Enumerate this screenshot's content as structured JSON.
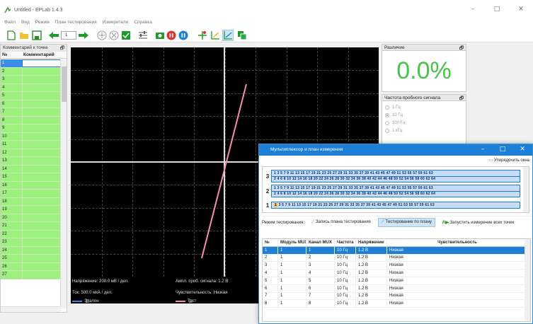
{
  "window": {
    "title": "Untitled - EPLab 1.4.3",
    "min": "–",
    "max": "□",
    "close": "✕"
  },
  "menu": [
    "Файл",
    "Вид",
    "Режим",
    "План тестирования",
    "Измерители",
    "Справка"
  ],
  "toolbar": {
    "point_number": "1"
  },
  "left_panel": {
    "title": "Комментарий к точке",
    "pin": "🗗",
    "col_num": "№",
    "col_comment": "Комментарий",
    "rows": [
      "1",
      "2",
      "3",
      "4",
      "5",
      "6",
      "7",
      "8",
      "9",
      "10",
      "11",
      "12",
      "13",
      "14",
      "15",
      "16",
      "17",
      "18",
      "19",
      "20",
      "21",
      "22",
      "23",
      "24",
      "25",
      "26",
      "27"
    ]
  },
  "plot": {
    "voltage": "Напряжение: 200.0 мВ / дел.",
    "amplitude": "Ампл. проб. сигнала: 1.2 В",
    "current": "Ток: 500.0 мкА / дел.",
    "sensitivity": "Чувствительность: Низкая",
    "legend_ref": "Эталон",
    "legend_test": "Тест",
    "ref_color": "#2e86de",
    "test_color": "#f48fb1"
  },
  "right_panel": {
    "diff_title": "Различие",
    "diff_value": "0.0%",
    "diff_color": "#48c34a",
    "freq_title": "Частота пробного сигнала",
    "freq_options": [
      "1 Гц",
      "10 Гц",
      "100 Гц",
      "1 кГц"
    ],
    "pin": "🗗"
  },
  "dialog": {
    "title": "Мультиплексор и план измерения",
    "arrange": "Упорядочить окна",
    "mux_rows": [
      {
        "label": "3",
        "odd": "1 3 5 7 9 11 13 15 17 19 21 23 25 27 29 31 33 35 37 39 41 43 45 47 49 51 53 55 57 59 61 63",
        "even": "2 4 6 8 10 12 14 16 18 20 22 24 26 28 30 32 34 36 38 40 42 44 46 48 50 52 54 56 58 60 62 64"
      },
      {
        "label": "2",
        "odd": "1 3 5 7 9 11 13 15 17 19 21 23 25 27 29 31 33 35 37 39 41 43 45 47 49 51 53 55 57 59 61 63",
        "even": "2 4 6 8 10 12 14 16 18 20 22 24 26 28 30 32 34 36 38 40 42 44 46 48 50 52 54 56 58 60 62 64"
      },
      {
        "label": "1",
        "first": "1",
        "odd": "3 5 7 9 11 13 15 17 19 21 23 25 27 29 31 33 35 37 39 41 43 45 47 49 51 53 55 57 59 61 63"
      }
    ],
    "mode_label": "Режим тестирования:",
    "mode_write": "Запись плана тестирования",
    "mode_plan": "Тестирование по плану",
    "run_all": "Запустить измерение всех точек",
    "columns": [
      "№",
      "Модуль MUX",
      "Канал MUX",
      "Частота",
      "Напряжение",
      "Чувствительность"
    ],
    "rows": [
      [
        "1",
        "1",
        "1",
        "10 Гц",
        "1.2 В",
        "Низкая"
      ],
      [
        "2",
        "1",
        "2",
        "10 Гц",
        "1.2 В",
        "Низкая"
      ],
      [
        "3",
        "1",
        "3",
        "10 Гц",
        "1.2 В",
        "Низкая"
      ],
      [
        "4",
        "1",
        "4",
        "10 Гц",
        "1.2 В",
        "Низкая"
      ],
      [
        "5",
        "1",
        "5",
        "10 Гц",
        "1.2 В",
        "Низкая"
      ],
      [
        "6",
        "1",
        "6",
        "10 Гц",
        "1.2 В",
        "Низкая"
      ],
      [
        "7",
        "1",
        "7",
        "10 Гц",
        "1.2 В",
        "Низкая"
      ],
      [
        "8",
        "1",
        "8",
        "10 Гц",
        "1.2 В",
        "Низкая"
      ]
    ]
  }
}
